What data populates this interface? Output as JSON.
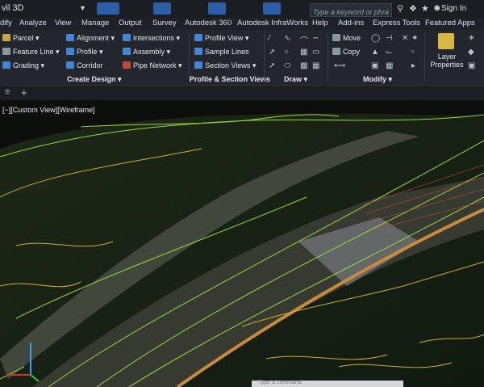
{
  "title_bar": {
    "app_title": "vil 3D",
    "search_placeholder": "Type a keyword or phrase",
    "sign_in_label": "Sign In"
  },
  "menu": {
    "items": [
      "dify",
      "Analyze",
      "View",
      "Manage",
      "Output",
      "Survey",
      "Autodesk 360",
      "Autodesk InfraWorks",
      "Help",
      "Add-ins",
      "Express Tools",
      "Featured Apps"
    ]
  },
  "ribbon": {
    "create_design": {
      "parcel": "Parcel",
      "feature_line": "Feature Line",
      "grading": "Grading",
      "alignment": "Alignment",
      "profile": "Profile",
      "corridor": "Corridor",
      "intersections": "Intersections",
      "assembly": "Assembly",
      "pipe_network": "Pipe Network",
      "group_label": "Create Design"
    },
    "profile_section": {
      "profile_view": "Profile View",
      "sample_lines": "Sample Lines",
      "section_views": "Section Views",
      "group_label": "Profile & Section Views"
    },
    "draw": {
      "group_label": "Draw"
    },
    "modify": {
      "move": "Move",
      "copy": "Copy",
      "group_label": "Modify"
    },
    "layers": {
      "layer_properties": "Layer Properties"
    }
  },
  "viewport": {
    "view_label": "[−][Custom View][Wireframe]"
  },
  "command_line": {
    "placeholder": "Type a command"
  },
  "colors": {
    "ribbon_bg": "#23272d",
    "title_bg": "#1a1d22",
    "terrain_dark": "#1a2114",
    "contour_green": "#9bd63a",
    "contour_yellow": "#c9b22e",
    "road_orange": "#c98a3a"
  },
  "icons": [
    "search-icon",
    "star-icon",
    "user-icon",
    "help-icon",
    "ucs-axes-icon",
    "plus-icon"
  ]
}
